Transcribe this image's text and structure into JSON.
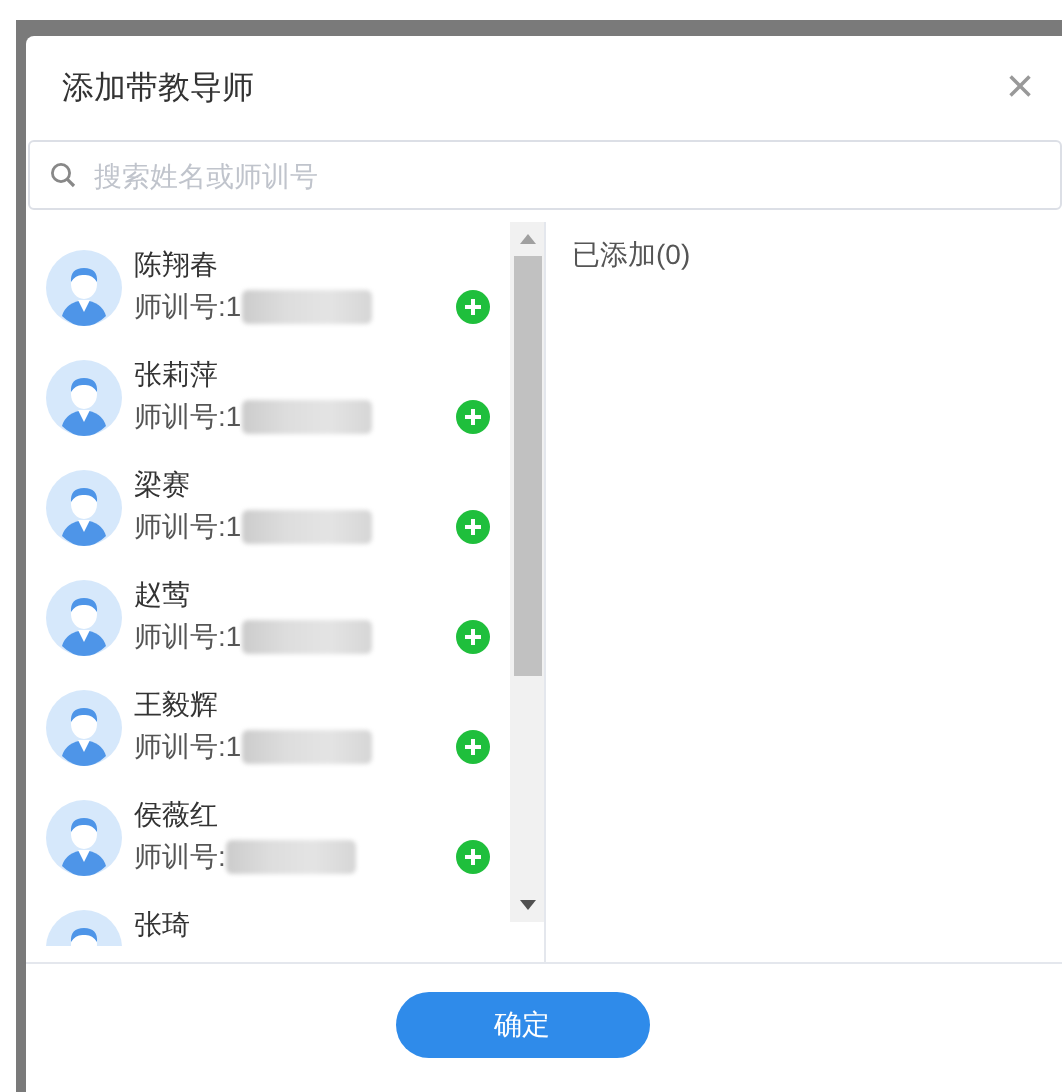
{
  "dialog": {
    "title": "添加带教导师",
    "close": "×"
  },
  "search": {
    "placeholder": "搜索姓名或师训号"
  },
  "teachers": [
    {
      "name": "陈翔春",
      "id": "师训号:1"
    },
    {
      "name": "张莉萍",
      "id": "师训号:1"
    },
    {
      "name": "梁赛",
      "id": "师训号:1"
    },
    {
      "name": "赵莺",
      "id": "师训号:1"
    },
    {
      "name": "王毅辉",
      "id": "师训号:1"
    },
    {
      "name": "侯薇红",
      "id": "师训号:"
    },
    {
      "name": "张琦"
    }
  ],
  "added": {
    "label": "已添加(0)"
  },
  "confirm": "确定"
}
